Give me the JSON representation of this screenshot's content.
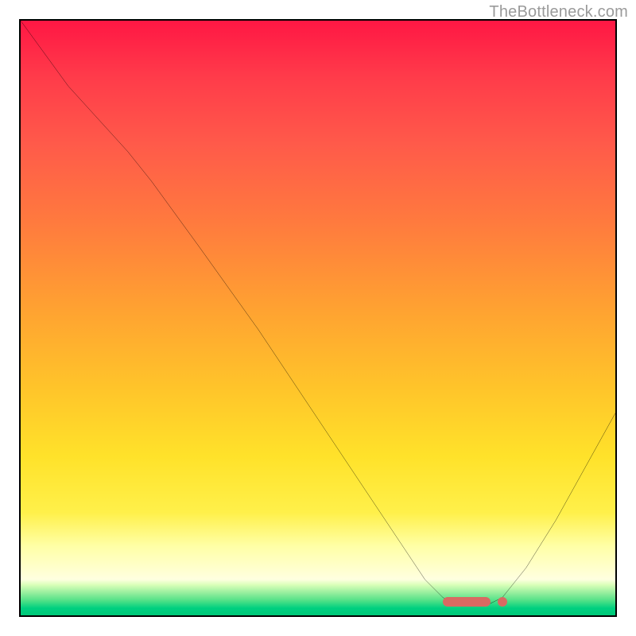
{
  "watermark": "TheBottleneck.com",
  "chart_data": {
    "type": "line",
    "title": "",
    "xlabel": "",
    "ylabel": "",
    "xlim": [
      0,
      100
    ],
    "ylim": [
      0,
      100
    ],
    "grid": false,
    "curve_points": [
      {
        "x": 0,
        "y": 100
      },
      {
        "x": 8,
        "y": 89
      },
      {
        "x": 18,
        "y": 78
      },
      {
        "x": 22,
        "y": 73
      },
      {
        "x": 30,
        "y": 62
      },
      {
        "x": 40,
        "y": 48
      },
      {
        "x": 50,
        "y": 33
      },
      {
        "x": 58,
        "y": 21
      },
      {
        "x": 64,
        "y": 12
      },
      {
        "x": 68,
        "y": 6
      },
      {
        "x": 71,
        "y": 3
      },
      {
        "x": 74,
        "y": 1.5
      },
      {
        "x": 78,
        "y": 1.5
      },
      {
        "x": 81,
        "y": 3
      },
      {
        "x": 85,
        "y": 8
      },
      {
        "x": 90,
        "y": 16
      },
      {
        "x": 95,
        "y": 25
      },
      {
        "x": 100,
        "y": 34
      }
    ],
    "marker_bar": {
      "x_start": 71,
      "x_end": 79,
      "y": 2.3,
      "width": 8,
      "height": 1.6,
      "color": "#d86a62"
    },
    "marker_dot": {
      "x": 81,
      "y": 2.3,
      "r": 0.8,
      "color": "#d86a62"
    },
    "background": {
      "gradient_top_to_bottom": [
        "#ff1744",
        "#ff7a3e",
        "#ffe22a",
        "#ffffe0",
        "#00c878"
      ]
    }
  }
}
